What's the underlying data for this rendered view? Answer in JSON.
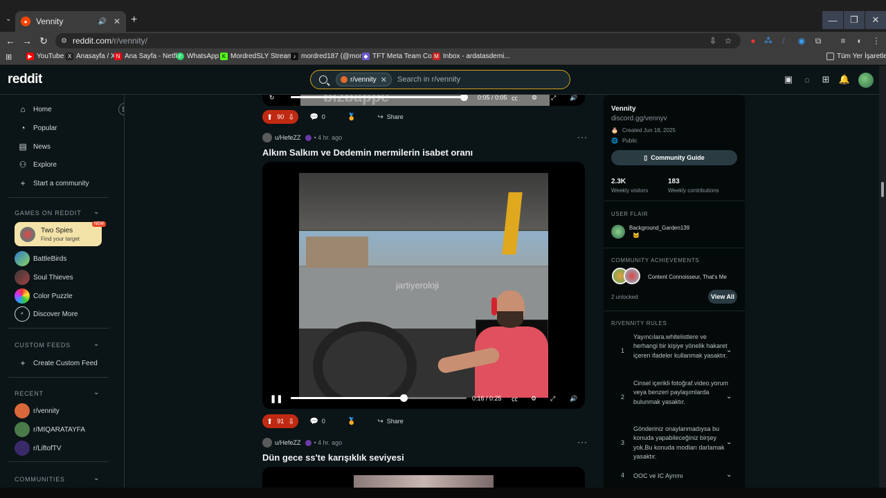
{
  "browser": {
    "tab_title": "Vennity",
    "url_host": "reddit.com",
    "url_path": "/r/vennity/",
    "bookmarks": [
      {
        "label": "YouTube",
        "color": "#ff0000"
      },
      {
        "label": "Anasayfa / X",
        "color": "#222222"
      },
      {
        "label": "Ana Sayfa - Netflix",
        "color": "#e50914"
      },
      {
        "label": "WhatsApp",
        "color": "#25d366"
      },
      {
        "label": "MordredSLY Stream...",
        "color": "#53fc18"
      },
      {
        "label": "mordred187 (@mor...",
        "color": "#111111"
      },
      {
        "label": "TFT Meta Team Co...",
        "color": "#6a5acd"
      },
      {
        "label": "Inbox - ardatasdemi...",
        "color": "#c5221f"
      }
    ],
    "all_bookmarks_label": "Tüm Yer İşaretleri"
  },
  "header": {
    "logo": "reddit",
    "search_chip": "r/vennity",
    "search_placeholder": "Search in r/vennity"
  },
  "sidebar": {
    "nav": [
      "Home",
      "Popular",
      "News",
      "Explore",
      "Start a community"
    ],
    "games_heading": "GAMES ON REDDIT",
    "featured_game": {
      "title": "Two Spies",
      "subtitle": "Find your target",
      "badge": "NEW"
    },
    "games": [
      "BattleBirds",
      "Soul Thieves",
      "Color Puzzle",
      "Discover More"
    ],
    "custom_feeds_heading": "CUSTOM FEEDS",
    "create_feed": "Create Custom Feed",
    "recent_heading": "RECENT",
    "recent": [
      "r/vennity",
      "r/MIQARATAYFA",
      "r/LiftofTV"
    ],
    "communities_heading": "COMMUNITIES"
  },
  "feed": {
    "top_post": {
      "time": "0:05 / 0:05",
      "votes": "90",
      "comments": "0",
      "share": "Share",
      "overlay_text": "bizbappe"
    },
    "post1": {
      "user": "u/HefeZZ",
      "time": "4 hr. ago",
      "title": "Alkım Salkım ve Dedemin mermilerin isabet oranı",
      "watermark": "jartiyeroloji",
      "video_time": "0:16 / 0:25",
      "progress": 0.64,
      "votes": "91",
      "comments": "0",
      "share": "Share"
    },
    "post2": {
      "user": "u/HefeZZ",
      "time": "4 hr. ago",
      "title": "Dün gece ss'te karışıklık seviyesi"
    }
  },
  "right": {
    "name": "Vennity",
    "link": "discord.gg/vennyv",
    "created": "Created Jun 18, 2025",
    "visibility": "Public",
    "guide_button": "Community Guide",
    "stats": [
      {
        "value": "2.3K",
        "label": "Weekly visitors"
      },
      {
        "value": "183",
        "label": "Weekly contributions"
      }
    ],
    "user_flair_heading": "USER FLAIR",
    "flair_user": "Background_Garden139",
    "achievements_heading": "COMMUNITY ACHIEVEMENTS",
    "achievements_text": "Content Connoisseur, That's Me",
    "unlocked": "2 unlocked",
    "view_all": "View All",
    "rules_heading": "R/VENNITY RULES",
    "rules": [
      {
        "num": "1",
        "text": "Yayıncılara.whitelistlere ve herhangi bir kişiye yönelik hakaret içeren ifadeler kullanmak yasaktır."
      },
      {
        "num": "2",
        "text": "Cinsel içerikli fotoğraf.video.yorum veya benzeri paylaşımlarda bulunmak yasaktır."
      },
      {
        "num": "3",
        "text": "Gönderiniz onaylanmadıysa bu konuda yapabileceğiniz birşey yok.Bu konuda modları darlamak yasaktır."
      },
      {
        "num": "4",
        "text": "OOC ve IC Ayrımı"
      }
    ]
  },
  "colors": {
    "accent": "#ff4500",
    "upvoted": "#c12a12",
    "search_border": "#d4a21c"
  }
}
